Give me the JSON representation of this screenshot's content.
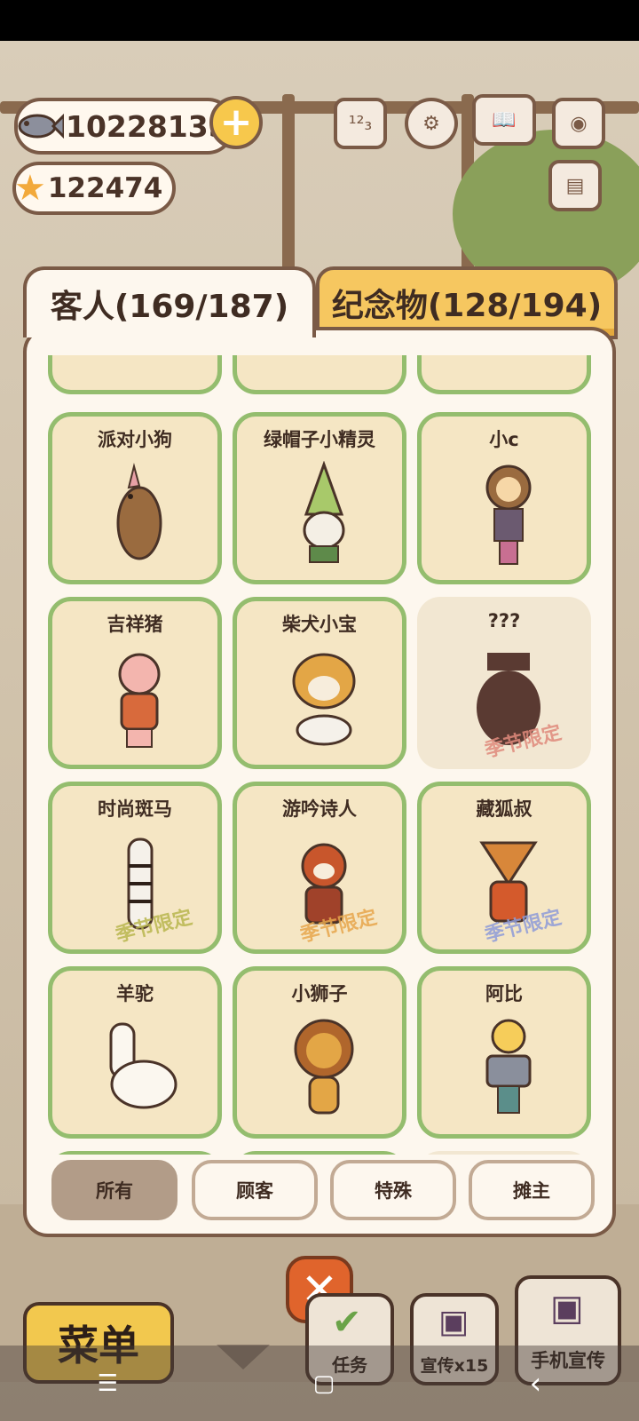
{
  "currencies": {
    "fish": "10228135",
    "stars": "122474"
  },
  "tabs": {
    "guests": "客人(169/187)",
    "souvenirs": "纪念物(128/194)"
  },
  "cards": [
    {
      "name": "派对小狗",
      "stamp": "",
      "stamp_color": ""
    },
    {
      "name": "绿帽子小精灵",
      "stamp": "",
      "stamp_color": ""
    },
    {
      "name": "小c",
      "stamp": "",
      "stamp_color": ""
    },
    {
      "name": "吉祥猪",
      "stamp": "",
      "stamp_color": ""
    },
    {
      "name": "柴犬小宝",
      "stamp": "",
      "stamp_color": ""
    },
    {
      "name": "???",
      "stamp": "季节限定",
      "stamp_color": "#e08a7c"
    },
    {
      "name": "时尚斑马",
      "stamp": "季节限定",
      "stamp_color": "#b9b64e"
    },
    {
      "name": "游吟诗人",
      "stamp": "季节限定",
      "stamp_color": "#e7a64c"
    },
    {
      "name": "藏狐叔",
      "stamp": "季节限定",
      "stamp_color": "#8e9bd8"
    },
    {
      "name": "羊驼",
      "stamp": "",
      "stamp_color": ""
    },
    {
      "name": "小狮子",
      "stamp": "",
      "stamp_color": ""
    },
    {
      "name": "阿比",
      "stamp": "",
      "stamp_color": ""
    }
  ],
  "filters": [
    "所有",
    "顾客",
    "特殊",
    "摊主"
  ],
  "bottom": {
    "menu": "菜单",
    "tasks": "任务",
    "promo": "宣传x15",
    "phone_promo": "手机宣传"
  },
  "nav": {
    "menu": "☰",
    "home": "▢",
    "back": "‹"
  },
  "colors": {
    "accent": "#f6c760",
    "card_border": "#94bd6e",
    "frame": "#7a5a46"
  }
}
